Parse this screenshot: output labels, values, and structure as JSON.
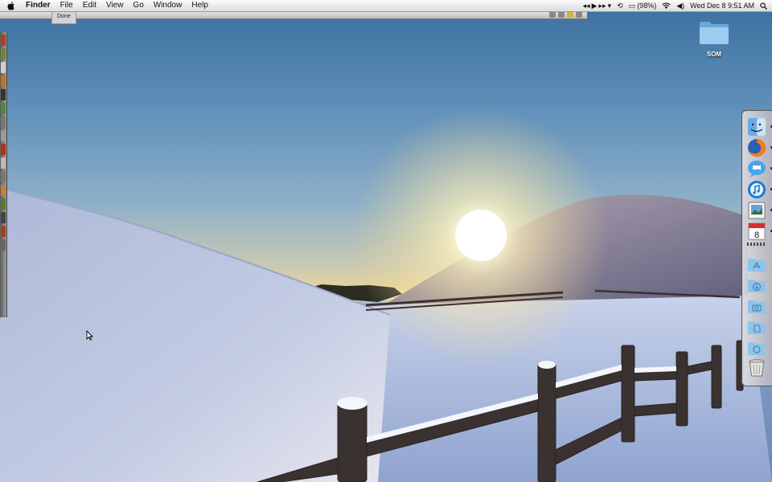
{
  "menubar": {
    "apple_icon": "apple-icon",
    "app_name": "Finder",
    "menus": [
      "File",
      "Edit",
      "View",
      "Go",
      "Window",
      "Help"
    ],
    "battery": "(98%)",
    "clock": "Wed Dec 8  9:51 AM"
  },
  "strip": {
    "status_text": "Done"
  },
  "desktop": {
    "folder_label": "SOM"
  },
  "dock": {
    "items": [
      {
        "name": "finder-icon",
        "running": true
      },
      {
        "name": "firefox-icon",
        "running": true
      },
      {
        "name": "ichat-icon",
        "running": true
      },
      {
        "name": "itunes-icon",
        "running": true
      },
      {
        "name": "preview-icon",
        "running": true
      },
      {
        "name": "ical-icon",
        "running": true,
        "text": "8"
      },
      {
        "name": "applications-folder-icon",
        "running": false
      },
      {
        "name": "downloads-folder-icon",
        "running": false
      },
      {
        "name": "pictures-folder-icon",
        "running": false
      },
      {
        "name": "documents-folder-icon",
        "running": false
      },
      {
        "name": "stacks-folder-icon",
        "running": false
      },
      {
        "name": "trash-icon",
        "running": false
      }
    ]
  },
  "colors": {
    "menubar": "#e8e8e8",
    "folder": "#8fc4ea",
    "sky_top": "#3b6f9e"
  }
}
